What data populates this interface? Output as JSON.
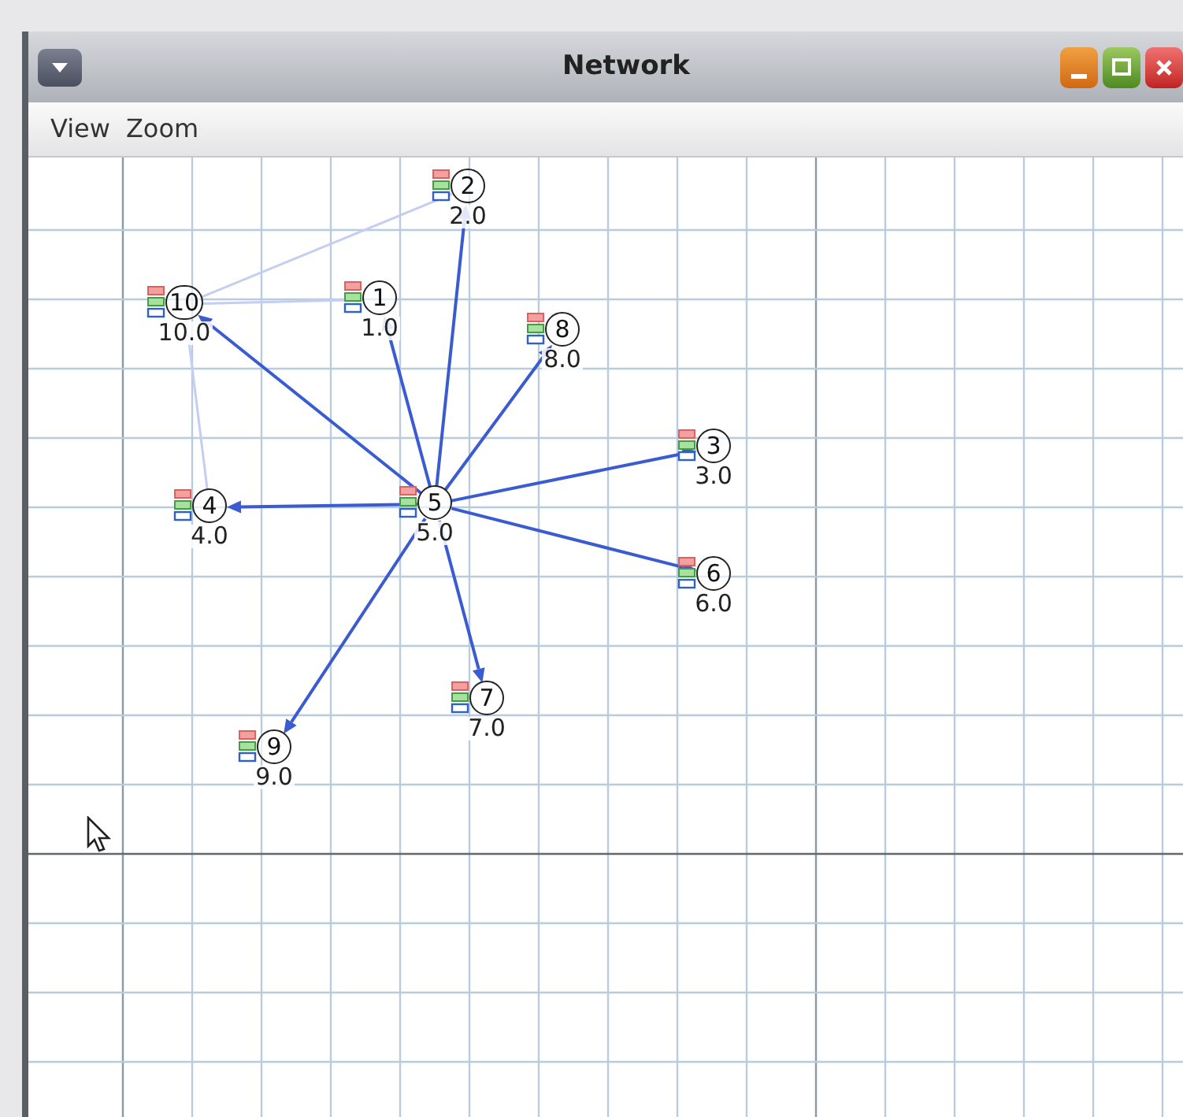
{
  "window": {
    "title": "Network"
  },
  "menu": [
    "View",
    "Zoom"
  ],
  "nodes": [
    {
      "number": "1",
      "value": "1.0"
    },
    {
      "number": "2",
      "value": "2.0"
    },
    {
      "number": "3",
      "value": "3.0"
    },
    {
      "number": "4",
      "value": "4.0"
    },
    {
      "number": "5",
      "value": "5.0"
    },
    {
      "number": "6",
      "value": "6.0"
    },
    {
      "number": "7",
      "value": "7.0"
    },
    {
      "number": "8",
      "value": "8.0"
    },
    {
      "number": "9",
      "value": "9.0"
    },
    {
      "number": "10",
      "value": "10.0"
    }
  ]
}
